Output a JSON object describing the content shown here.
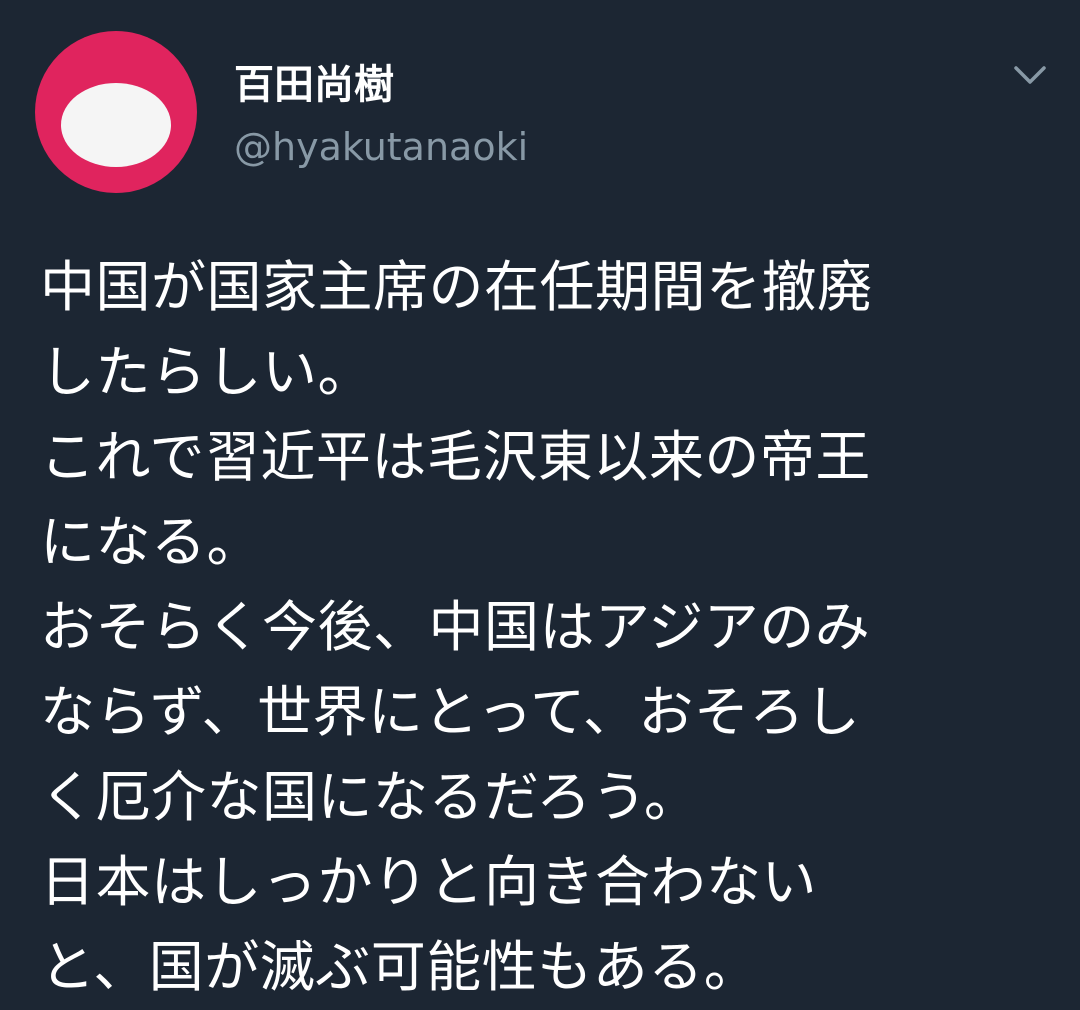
{
  "tweet": {
    "author": {
      "display_name": "百田尚樹",
      "username": "@hyakutanaoki",
      "avatar_color": "#e0245e"
    },
    "menu_icon": "chevron-down-icon",
    "text_lines": [
      "中国が国家主席の在任期間を撤廃",
      "したらしい。",
      "これで習近平は毛沢東以来の帝王",
      "になる。",
      "おそらく今後、中国はアジアのみ",
      "ならず、世界にとって、おそろし",
      "く厄介な国になるだろう。",
      "日本はしっかりと向き合わない",
      "と、国が滅ぶ可能性もある。"
    ]
  },
  "colors": {
    "background": "#1c2633",
    "text": "#ffffff",
    "secondary_text": "#8899a6"
  }
}
